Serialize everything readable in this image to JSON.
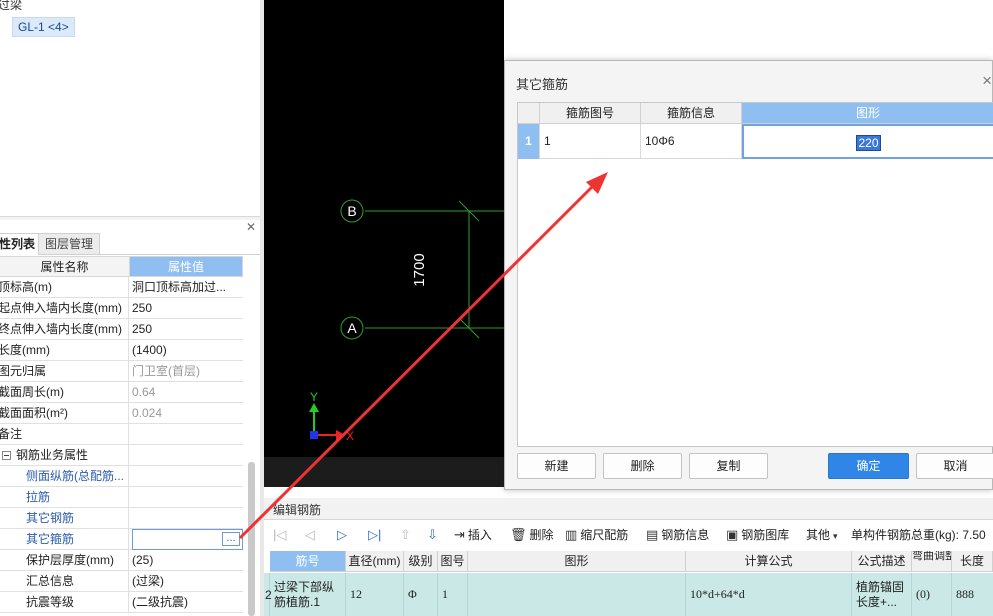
{
  "tree": {
    "title": "过梁",
    "node": "GL-1 <4>"
  },
  "left_tabs": [
    "性列表",
    "图层管理"
  ],
  "props": {
    "col_name": "属性名称",
    "col_value": "属性值",
    "rows": [
      {
        "name": "顶标高(m)",
        "value": "洞口顶标高加过..."
      },
      {
        "name": "起点伸入墙内长度(mm)",
        "value": "250"
      },
      {
        "name": "终点伸入墙内长度(mm)",
        "value": "250"
      },
      {
        "name": "长度(mm)",
        "value": "(1400)"
      },
      {
        "name": "图元归属",
        "value": "门卫室(首层)"
      },
      {
        "name": "截面周长(m)",
        "value": "0.64"
      },
      {
        "name": "截面面积(m²)",
        "value": "0.024"
      },
      {
        "name": "备注",
        "value": ""
      },
      {
        "name": "钢筋业务属性",
        "value": ""
      },
      {
        "name": "侧面纵筋(总配筋...",
        "value": ""
      },
      {
        "name": "拉筋",
        "value": ""
      },
      {
        "name": "其它钢筋",
        "value": ""
      },
      {
        "name": "其它箍筋",
        "value": ""
      },
      {
        "name": "保护层厚度(mm)",
        "value": "(25)"
      },
      {
        "name": "汇总信息",
        "value": "(过梁)"
      },
      {
        "name": "抗震等级",
        "value": "(二级抗震)"
      }
    ],
    "dots": "..."
  },
  "canvas": {
    "axis_b": "B",
    "axis_a": "A",
    "dimension": "1700",
    "ucs_y": "Y",
    "ucs_x": "X"
  },
  "dialog": {
    "title": "其它箍筋",
    "close": "×",
    "columns": [
      "箍筋图号",
      "箍筋信息",
      "图形"
    ],
    "row": {
      "num": "1",
      "fig_no": "1",
      "info": "10Φ6",
      "shape": "220"
    },
    "buttons": {
      "new": "新建",
      "delete": "删除",
      "copy": "复制",
      "ok": "确定",
      "cancel": "取消"
    }
  },
  "editor": {
    "title": "编辑钢筋",
    "toolbar": {
      "insert": "插入",
      "delete": "删除",
      "scale": "缩尺配筋",
      "info": "钢筋信息",
      "library": "钢筋图库",
      "other": "其他",
      "total": "单构件钢筋总重(kg): 7.50"
    },
    "columns": [
      "筋号",
      "直径(mm)",
      "级别",
      "图号",
      "图形",
      "计算公式",
      "公式描述",
      "弯曲调整",
      "长度"
    ],
    "row": {
      "num": "2",
      "name": "过梁下部纵筋植筋.1",
      "diameter": "12",
      "grade": "Φ",
      "fig_no": "1",
      "formula": "10*d+64*d",
      "desc": "植筋锚固长度+...",
      "bend": "(0)",
      "length": "888"
    }
  },
  "colors": {
    "accent": "#8fbff0",
    "ok_button": "#2f86e6",
    "cad_green": "#2ca02c",
    "arrow_red": "#ee3333",
    "row_highlight": "#c9e8e6"
  }
}
